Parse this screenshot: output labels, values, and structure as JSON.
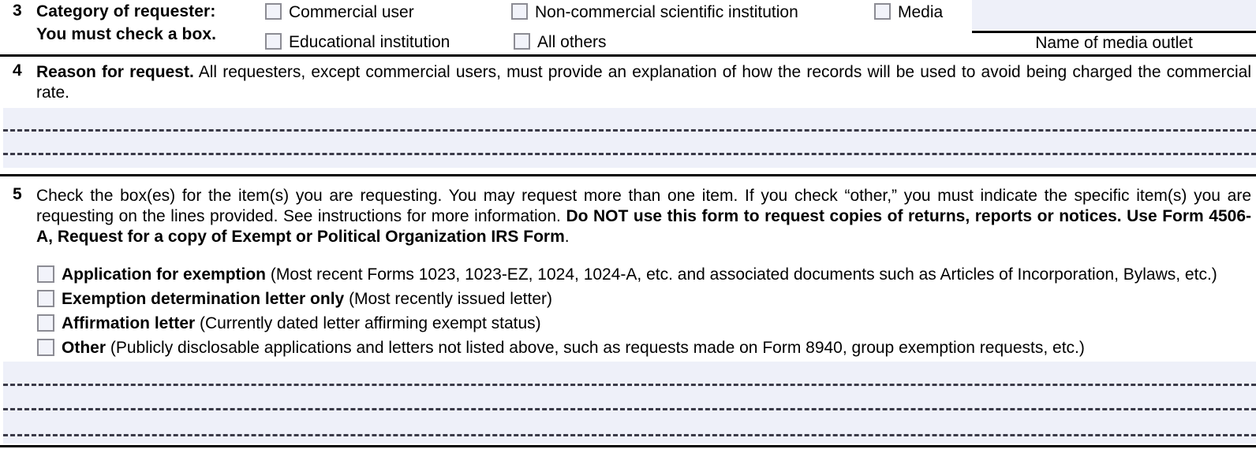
{
  "colors": {
    "shade_fill": "#eef0f9",
    "checkbox_fill": "#f2f3fa",
    "checkbox_border": "#8c8c94",
    "rule": "#000000",
    "dash": "#3a3a48"
  },
  "line3": {
    "number": "3",
    "label_line1": "Category of requester:",
    "label_line2": "You must check a box.",
    "options": [
      {
        "label": "Commercial user",
        "checked": false
      },
      {
        "label": "Non-commercial scientific institution",
        "checked": false
      },
      {
        "label": "Media",
        "checked": false
      },
      {
        "label": "Educational institution",
        "checked": false
      },
      {
        "label": "All others",
        "checked": false
      }
    ],
    "media_outlet": {
      "value": "",
      "placeholder": "",
      "caption": "Name of media outlet"
    }
  },
  "line4": {
    "number": "4",
    "heading": "Reason for request.",
    "text": " All requesters, except commercial users, must provide an explanation of how the records will be used to avoid being charged the commercial rate.",
    "entry_value": ""
  },
  "line5": {
    "number": "5",
    "text_part1": "Check the box(es) for the item(s) you are requesting. You may request more than one item. If you check “other,” you must indicate the specific item(s) you are requesting on the lines provided. See instructions for more information. ",
    "text_bold": "Do NOT use this form to request copies of returns, reports or notices. Use Form 4506-A, Request for a copy of Exempt or Political Organization IRS Form",
    "text_part2": ".",
    "items": [
      {
        "bold": "Application for exemption",
        "rest": " (Most recent Forms 1023, 1023-EZ, 1024, 1024-A, etc. and associated documents such as Articles of Incorporation, Bylaws, etc.)",
        "checked": false
      },
      {
        "bold": "Exemption determination letter only",
        "rest": " (Most recently issued letter)",
        "checked": false
      },
      {
        "bold": "Affirmation letter",
        "rest": " (Currently dated letter affirming exempt status)",
        "checked": false
      },
      {
        "bold": "Other",
        "rest": " (Publicly disclosable applications and letters not listed above, such as requests made on Form 8940, group exemption requests, etc.)",
        "checked": false
      }
    ],
    "entry_value": ""
  }
}
